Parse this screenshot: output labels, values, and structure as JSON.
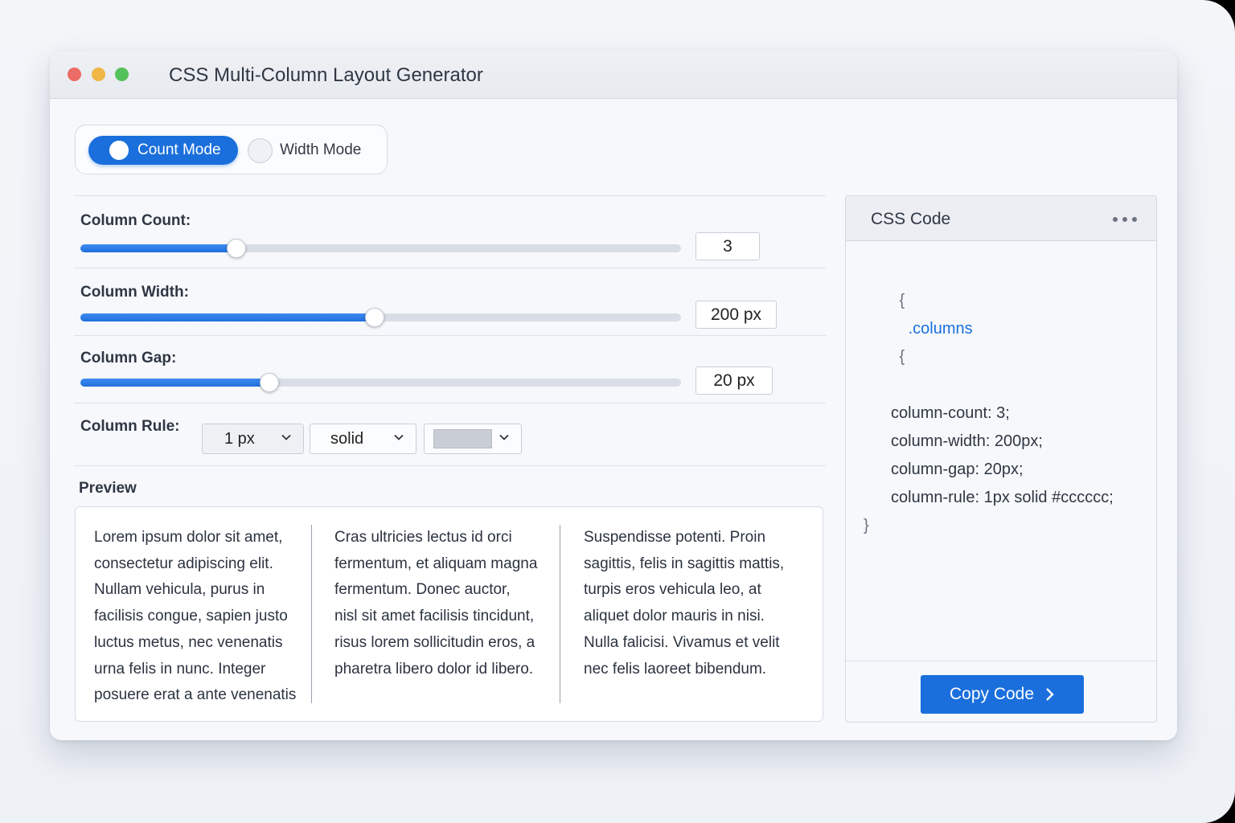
{
  "window": {
    "title": "CSS Multi-Column Layout Generator"
  },
  "mode": {
    "options": [
      {
        "label": "Count Mode",
        "selected": true
      },
      {
        "label": "Width Mode",
        "selected": false
      }
    ]
  },
  "controls": {
    "column_count": {
      "label": "Column Count:",
      "value": "3",
      "fraction": 0.26
    },
    "column_width": {
      "label": "Column Width:",
      "value": "200 px",
      "fraction": 0.49
    },
    "column_gap": {
      "label": "Column Gap:",
      "value": "20 px",
      "fraction": 0.315
    },
    "column_rule": {
      "label": "Column Rule:",
      "width": "1 px",
      "style": "solid",
      "color": "#cccccc"
    }
  },
  "preview": {
    "label": "Preview",
    "columns": [
      [
        "Lorem ipsum dolor sit amet,",
        "consectetur adipiscing elit.",
        "Nullam vehicula, purus in",
        "facilisis congue, sapien justo",
        "luctus metus, nec venenatis",
        "urna felis in nunc. Integer",
        "posuere erat a ante venenatis"
      ],
      [
        "Cras ultricies lectus id orci",
        "fermentum, et aliquam magna",
        "fermentum. Donec auctor,",
        "nisl sit amet facilisis tincidunt,",
        "risus lorem sollicitudin eros, a",
        "pharetra libero dolor id libero."
      ],
      [
        "Suspendisse potenti. Proin",
        "sagittis, felis in sagittis mattis,",
        "turpis eros vehicula leo, at",
        "aliquet dolor mauris in nisi.",
        "Nulla falicisi. Vivamus et velit",
        "nec felis laoreet bibendum."
      ]
    ]
  },
  "code_panel": {
    "title": "CSS Code",
    "open_brace": "{",
    "selector": ".columns",
    "selector_brace": "{",
    "lines": [
      "column-count: 3;",
      "column-width: 200px;",
      "column-gap: 20px;",
      "column-rule: 1px solid #cccccc;"
    ],
    "close_brace": "}",
    "copy_label": "Copy Code",
    "more_icon": "ellipsis-icon"
  },
  "colors": {
    "accent": "#1a6fdc",
    "rule_swatch": "#c9ced6"
  }
}
